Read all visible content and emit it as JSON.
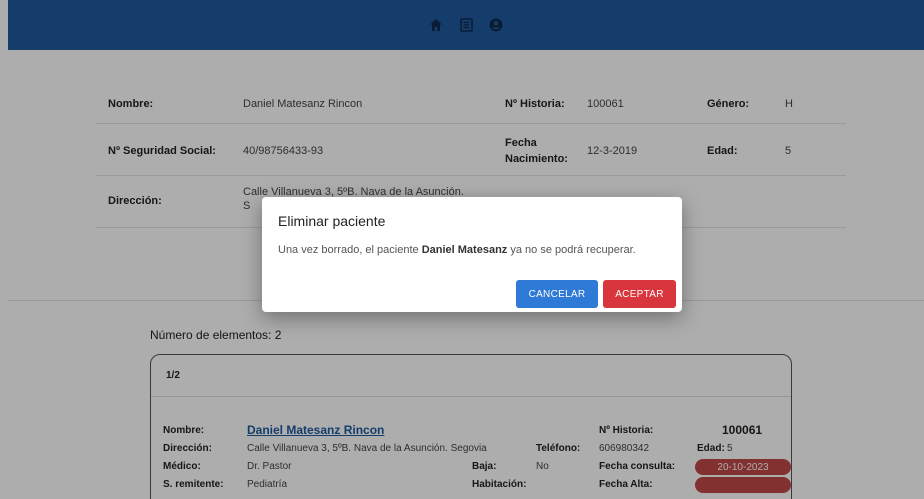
{
  "nav": {
    "icons": [
      "home-icon",
      "list-icon",
      "user-icon"
    ],
    "color": "#1f5aa0"
  },
  "patient": {
    "name_label": "Nombre:",
    "name_value": "Daniel Matesanz Rincon",
    "history_label": "Nº Historia:",
    "history_value": "100061",
    "gender_label": "Género:",
    "gender_value": "H",
    "ss_label": "Nº Seguridad Social:",
    "ss_value": "40/98756433-93",
    "birth_label_1": "Fecha",
    "birth_label_2": "Nacimiento:",
    "birth_value": "12-3-2019",
    "age_label": "Edad:",
    "age_value": "5",
    "address_label": "Dirección:",
    "address_value_partial": "Calle Villanueva 3, 5ºB. Nava de la Asunción.",
    "address_value_line2": "S"
  },
  "list": {
    "count_text": "Número de elementos: 2",
    "card": {
      "pager": "1/2",
      "name_label": "Nombre:",
      "name_value": "Daniel Matesanz Rincon",
      "history_label": "Nº Historia:",
      "history_value": "100061",
      "address_label": "Dirección:",
      "address_value": "Calle Villanueva 3, 5ºB. Nava de la Asunción. Segovia",
      "phone_label": "Teléfono:",
      "phone_value": "606980342",
      "age_label": "Edad:",
      "age_value": "5",
      "doctor_label": "Médico:",
      "doctor_value": "Dr. Pastor",
      "leave_label": "Baja:",
      "leave_value": "No",
      "consult_label": "Fecha consulta:",
      "consult_value": "20-10-2023",
      "referrer_label": "S. remitente:",
      "referrer_value": "Pediatría",
      "room_label": "Habitación:",
      "discharge_label": "Fecha Alta:"
    }
  },
  "dialog": {
    "title": "Eliminar paciente",
    "msg_before": "Una vez borrado, el paciente ",
    "msg_name": "Daniel Matesanz",
    "msg_after": " ya no se podrá recuperar.",
    "cancel_label": "CANCELAR",
    "accept_label": "ACEPTAR"
  }
}
